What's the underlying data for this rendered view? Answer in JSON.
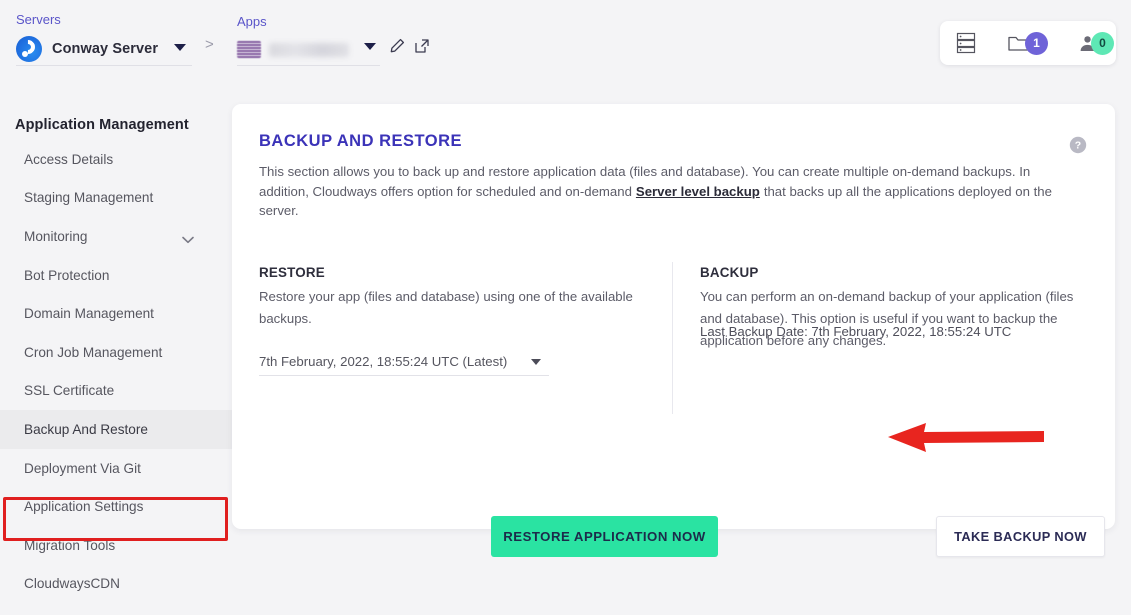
{
  "breadcrumb": {
    "servers_label": "Servers",
    "server_name": "Conway Server",
    "separator": ">",
    "apps_label": "Apps",
    "app_name": ""
  },
  "top_right": {
    "servers_icon": "server-stack-icon",
    "folder_icon": "folder-icon",
    "folder_count": "1",
    "user_icon": "user-icon",
    "user_count": "0"
  },
  "sidebar": {
    "title": "Application Management",
    "items": [
      {
        "label": "Access Details",
        "active": false,
        "chevron": false
      },
      {
        "label": "Staging Management",
        "active": false,
        "chevron": false
      },
      {
        "label": "Monitoring",
        "active": false,
        "chevron": true
      },
      {
        "label": "Bot Protection",
        "active": false,
        "chevron": false
      },
      {
        "label": "Domain Management",
        "active": false,
        "chevron": false
      },
      {
        "label": "Cron Job Management",
        "active": false,
        "chevron": false
      },
      {
        "label": "SSL Certificate",
        "active": false,
        "chevron": false
      },
      {
        "label": "Backup And Restore",
        "active": true,
        "chevron": false
      },
      {
        "label": "Deployment Via Git",
        "active": false,
        "chevron": false
      },
      {
        "label": "Application Settings",
        "active": false,
        "chevron": false
      },
      {
        "label": "Migration Tools",
        "active": false,
        "chevron": false
      },
      {
        "label": "CloudwaysCDN",
        "active": false,
        "chevron": false
      }
    ]
  },
  "card": {
    "title": "BACKUP AND RESTORE",
    "desc_part1": "This section allows you to back up and restore application data (files and database). You can create multiple on-demand backups. In addition, Cloudways offers option for scheduled and on-demand",
    "desc_link": "Server level backup",
    "desc_part2": "that backs up all the applications deployed on the server.",
    "help_icon": "help-circle-icon"
  },
  "restore": {
    "heading": "RESTORE",
    "description": "Restore your app (files and database) using one of the available backups.",
    "selected_backup": "7th February, 2022, 18:55:24 UTC (Latest)",
    "button_label": "RESTORE APPLICATION NOW"
  },
  "backup": {
    "heading": "BACKUP",
    "description": "You can perform an on-demand backup of your application (files and database). This option is useful if you want to backup the application before any changes.",
    "last_backup_date": "Last Backup Date: 7th February, 2022, 18:55:24 UTC",
    "button_label": "TAKE BACKUP NOW"
  },
  "annotations": {
    "highlight_color": "#e01f1f",
    "arrow_color": "#e8251f",
    "highlight_target": "Backup And Restore",
    "arrow_target": "TAKE BACKUP NOW"
  },
  "colors": {
    "accent_purple": "#3b33b8",
    "breadcrumb_link": "#5a55c9",
    "primary_green": "#2ae3a2",
    "badge_purple": "#6f63d8",
    "badge_green": "#5ee8b5",
    "page_bg": "#f4f4f6"
  }
}
